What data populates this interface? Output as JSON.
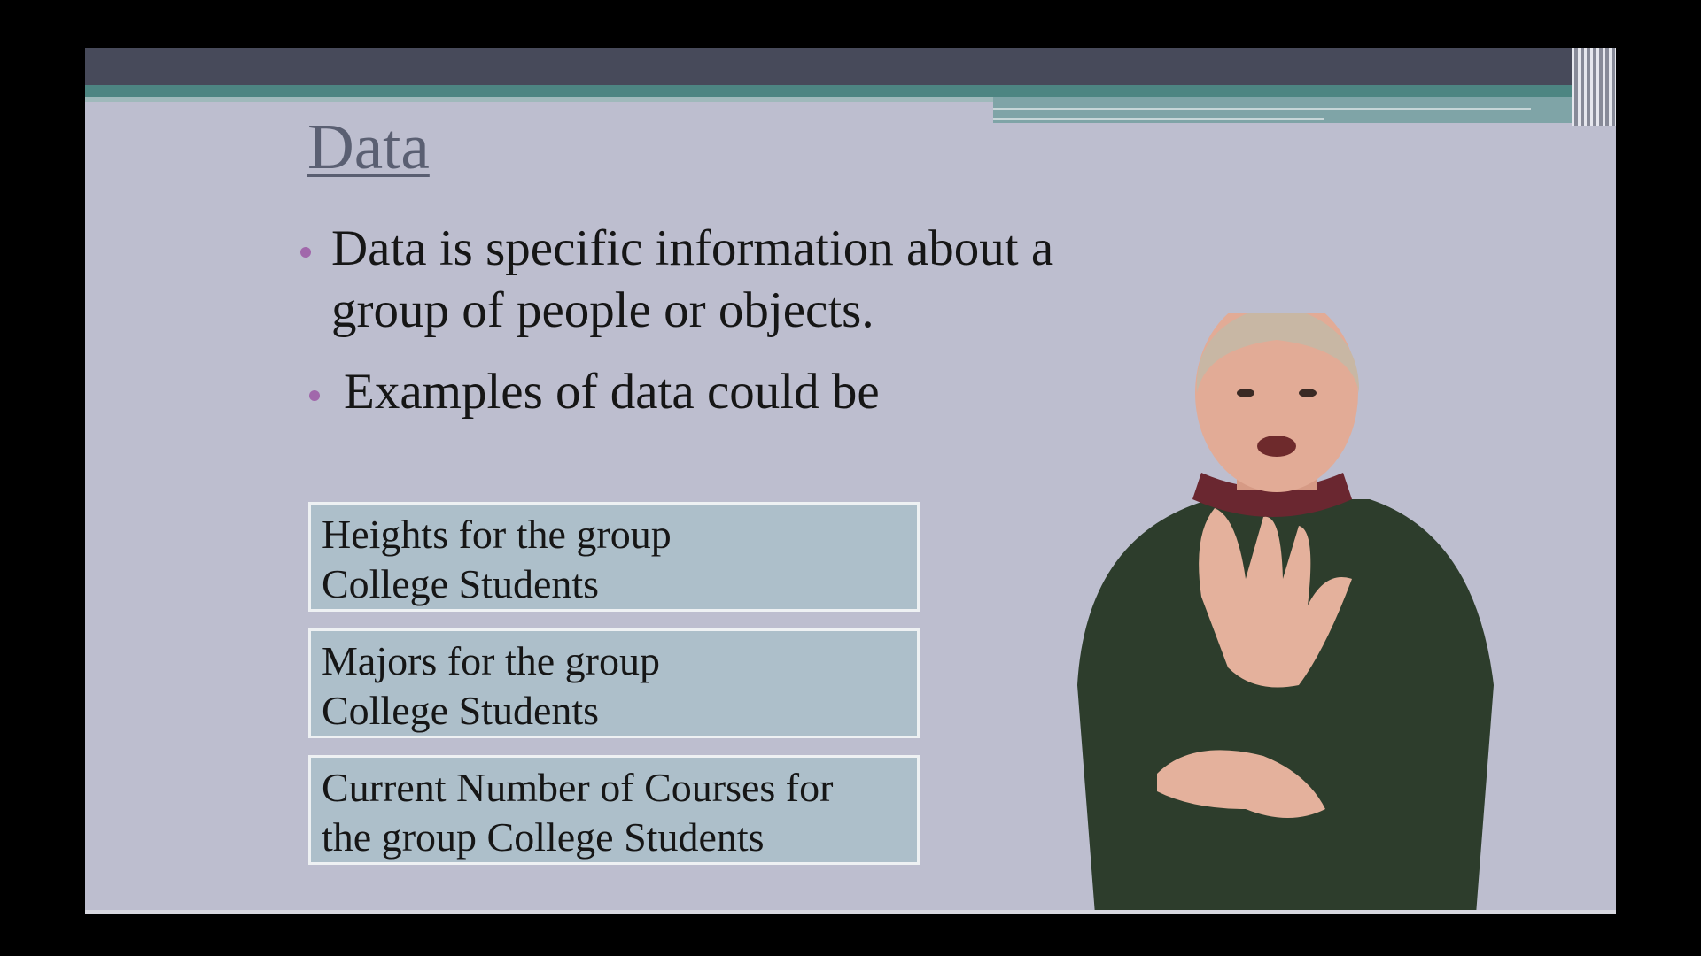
{
  "slide": {
    "title": "Data",
    "bullets": [
      "Data is specific information about a group of people or objects.",
      "Examples of data could be"
    ],
    "examples": [
      "Heights  for the group\nCollege Students",
      "Majors for the group\nCollege Students",
      "Current Number of Courses for\nthe group College Students"
    ]
  },
  "colors": {
    "background": "#bdbecf",
    "header_dark": "#474a5a",
    "header_teal": "#4d8582",
    "bullet": "#a168ab",
    "box_fill": "#adbfca",
    "title": "#5a5f72"
  }
}
